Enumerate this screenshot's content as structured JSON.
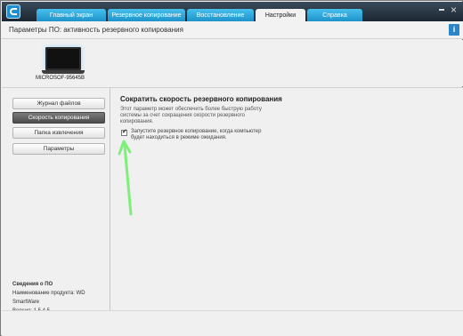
{
  "tabs": [
    {
      "label": "Главный экран",
      "active": false
    },
    {
      "label": "Резервное копирование",
      "active": false
    },
    {
      "label": "Восстановление",
      "active": false
    },
    {
      "label": "Настройки",
      "active": true
    },
    {
      "label": "Справка",
      "active": false
    }
  ],
  "window": {
    "minimize_icon": "minimize-icon",
    "close_icon": "close-icon",
    "close_glyph": "×"
  },
  "page": {
    "title": "Параметры ПО: активность резервного копирования",
    "info_label": "i"
  },
  "device": {
    "name": "MICROSOF-95645B",
    "icon": "laptop-icon"
  },
  "sidebar": {
    "items": [
      {
        "label": "Журнал файлов",
        "active": false
      },
      {
        "label": "Скорость копирования",
        "active": true
      },
      {
        "label": "Папка извлечения",
        "active": false
      },
      {
        "label": "Параметры",
        "active": false
      }
    ]
  },
  "about": {
    "heading": "Сведения о ПО",
    "product": "Наименование продукта: WD SmartWare",
    "version": "Версия: 1.5.4.5"
  },
  "settings": {
    "title": "Сократить скорость резервного копирования",
    "description": "Этот параметр может обеспечить более быструю работу системы за счет сокращения скорости резервного копирования.",
    "checkbox_label": "Запустите резервное копирование, когда компьютер будет находиться в режиме ожидания.",
    "checkbox_checked": true,
    "checkbox_glyph": "✔"
  },
  "colors": {
    "accent": "#1a90c8",
    "annotation_arrow": "#7df07a",
    "active_nav": "#5a5a5a"
  }
}
